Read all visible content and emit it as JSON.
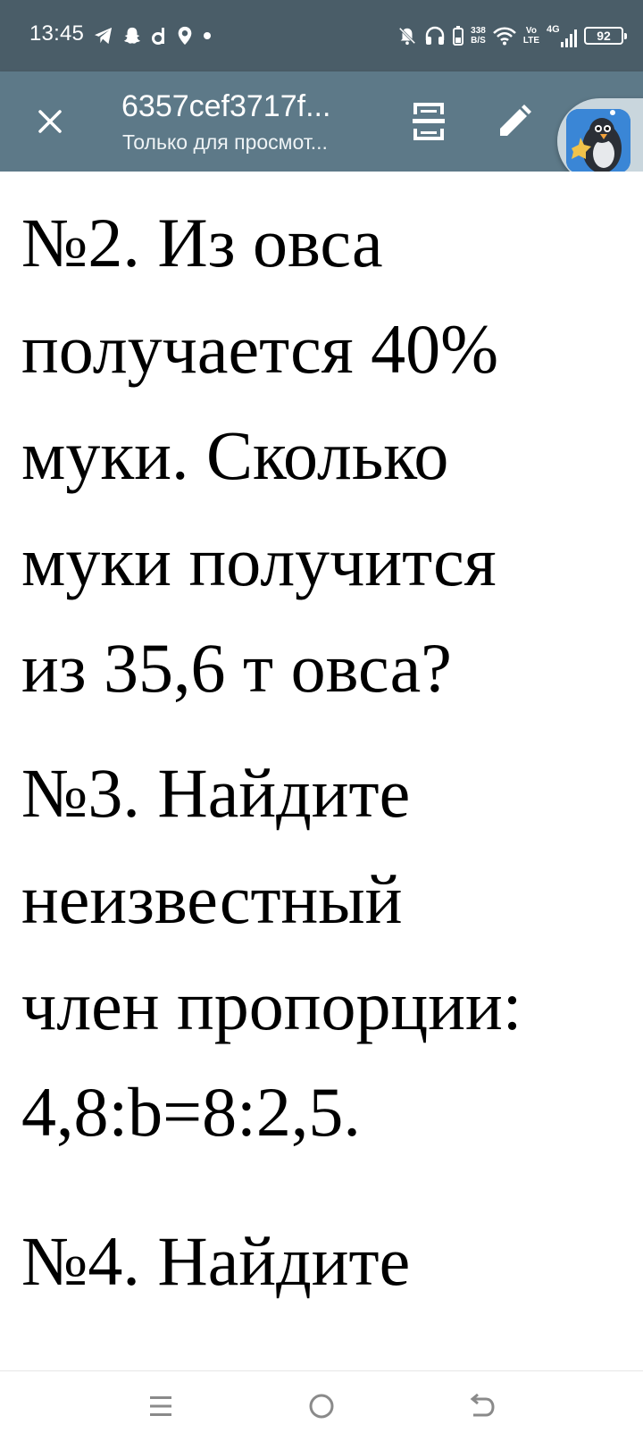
{
  "status_bar": {
    "time": "13:45",
    "net_speed_value": "338",
    "net_speed_unit": "B/S",
    "volte_top": "Vo",
    "volte_bottom": "LTE",
    "network_type": "4G",
    "battery_level": "92",
    "left_icons": [
      "telegram-icon",
      "snapchat-icon",
      "d-app-icon",
      "location-icon",
      "dot-icon"
    ],
    "right_icons": [
      "bell-muted-icon",
      "headphones-icon",
      "battery-saver-icon",
      "wifi-icon",
      "signal-icon",
      "battery-icon"
    ]
  },
  "app_bar": {
    "title": "6357cef3717f...",
    "subtitle": "Только для просмот..."
  },
  "document": {
    "problem2": "№2.  Из овса\nполучается 40%\nмуки. Сколько\nмуки получится\nиз 35,6 т овса?",
    "problem3": "№3. Найдите\nнеизвестный\nчлен пропорции:\n4,8:b=8:2,5.",
    "problem4": "№4. Найдите"
  },
  "colors": {
    "status_bar_bg": "#4a5d68",
    "app_bar_bg": "#5d7988",
    "text": "#000000"
  }
}
